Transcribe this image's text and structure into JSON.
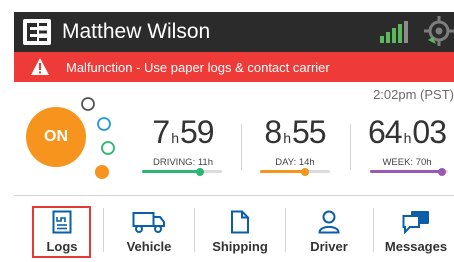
{
  "header": {
    "driver_name": "Matthew Wilson",
    "logo_icon": "eld-logo-icon",
    "signal_icon": "cell-signal-icon",
    "gps_icon": "gps-locate-icon",
    "bg_color": "#2b2b2b"
  },
  "alert": {
    "text": "Malfunction - Use paper logs & contact carrier",
    "icon": "warning-icon",
    "bg_color": "#ee3b37"
  },
  "status": {
    "time": "2:02pm (PST)",
    "duty_status": "ON",
    "duty_color": "#f7941d"
  },
  "timers": [
    {
      "hours": "7",
      "h": "h",
      "minutes": "59",
      "label": "DRIVING: 11h",
      "color": "#2bb673",
      "fill": 0.73
    },
    {
      "hours": "8",
      "h": "h",
      "minutes": "55",
      "label": "DAY: 14h",
      "color": "#f7941d",
      "fill": 0.64
    },
    {
      "hours": "64",
      "h": "h",
      "minutes": "03",
      "label": "WEEK: 70h",
      "color": "#9b59b6",
      "fill": 0.92
    }
  ],
  "nav": {
    "items": [
      {
        "label": "Logs",
        "icon": "logs-icon",
        "active": true
      },
      {
        "label": "Vehicle",
        "icon": "truck-icon"
      },
      {
        "label": "Shipping",
        "icon": "document-icon"
      },
      {
        "label": "Driver",
        "icon": "user-icon"
      },
      {
        "label": "Messages",
        "icon": "chat-icon"
      }
    ],
    "icon_color": "#0a5fa8",
    "highlight_color": "#e53935"
  }
}
